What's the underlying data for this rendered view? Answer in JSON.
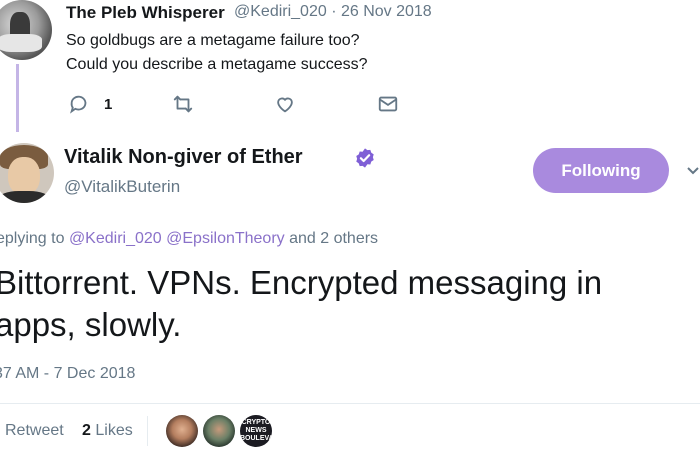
{
  "parent_tweet": {
    "author_name": "The Pleb Whisperer",
    "meta": "@Kediri_020 · 26 Nov 2018",
    "text_lines": [
      "So goldbugs are a metagame failure too?",
      "Could you describe a metagame success?"
    ],
    "reply_count": "1"
  },
  "main_tweet": {
    "author_name": "Vitalik Non-giver of Ether",
    "author_handle": "@VitalikButerin",
    "follow_label": "Following",
    "replying_prefix": "eplying to ",
    "replying_mention_1": "@Kediri_020",
    "replying_mention_2": "@EpsilonTheory",
    "replying_suffix": " and 2 others",
    "text_lines": [
      "Bittorrent. VPNs. Encrypted messaging in",
      "apps, slowly."
    ],
    "timestamp": "37 AM - 7 Dec 2018",
    "retweet_label": "Retweet",
    "likes_count": "2",
    "likes_label": "Likes",
    "liker_3_lines": [
      "CRYPTO",
      "NEWS",
      "BOULEVARD"
    ]
  },
  "colors": {
    "accent": "#a98ade",
    "link": "#8a71c9",
    "muted": "#657786",
    "verified": "#7f5fd6"
  },
  "icons": [
    "reply-icon",
    "retweet-icon",
    "like-icon",
    "direct-message-icon",
    "verified-badge-icon",
    "caret-down-icon"
  ]
}
